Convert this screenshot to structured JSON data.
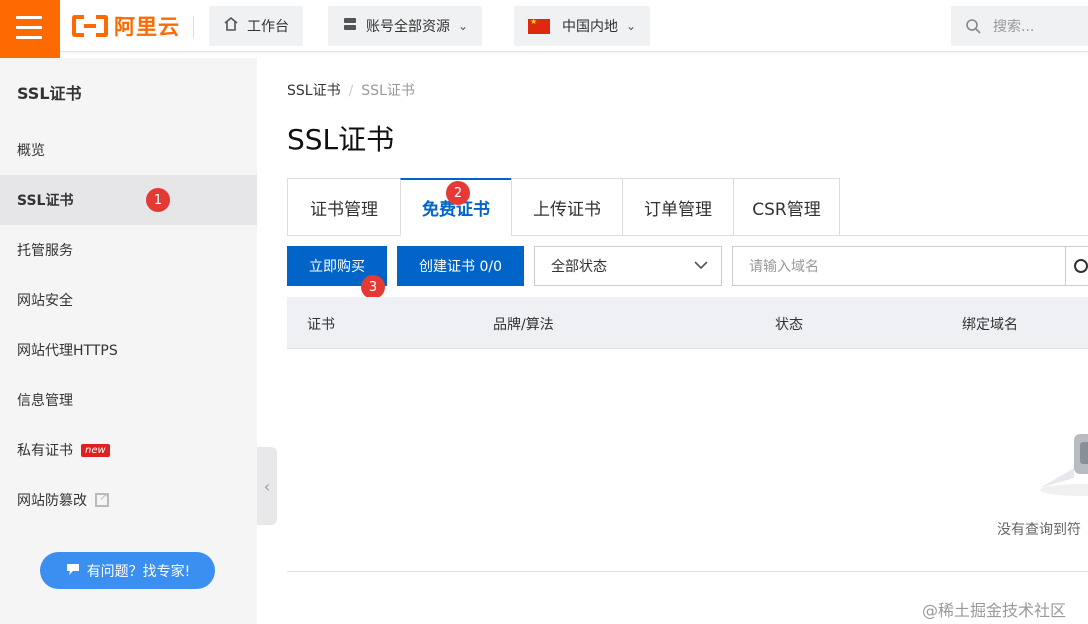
{
  "topbar": {
    "logo_text": "阿里云",
    "workbench": "工作台",
    "resources": "账号全部资源",
    "region": "中国内地",
    "search_placeholder": "搜索..."
  },
  "sidebar": {
    "title": "SSL证书",
    "items": [
      {
        "label": "概览"
      },
      {
        "label": "SSL证书"
      },
      {
        "label": "托管服务"
      },
      {
        "label": "网站安全"
      },
      {
        "label": "网站代理HTTPS"
      },
      {
        "label": "信息管理"
      },
      {
        "label": "私有证书"
      },
      {
        "label": "网站防篡改"
      }
    ],
    "new_tag": "new",
    "help_button": "有问题？找专家!"
  },
  "annotations": [
    "1",
    "2",
    "3"
  ],
  "breadcrumb": [
    "SSL证书",
    "SSL证书"
  ],
  "page_title": "SSL证书",
  "tabs": [
    {
      "label": "证书管理"
    },
    {
      "label": "免费证书"
    },
    {
      "label": "上传证书"
    },
    {
      "label": "订单管理"
    },
    {
      "label": "CSR管理"
    }
  ],
  "toolbar": {
    "buy_button": "立即购买",
    "create_button": "创建证书 0/0",
    "status_select": "全部状态",
    "domain_placeholder": "请输入域名"
  },
  "table": {
    "columns": [
      "证书",
      "品牌/算法",
      "状态",
      "绑定域名"
    ],
    "empty_text": "没有查询到符"
  },
  "watermark": "@稀土掘金技术社区",
  "colors": {
    "brand": "#ff6a00",
    "primary": "#0064c8",
    "badge": "#e53935"
  }
}
